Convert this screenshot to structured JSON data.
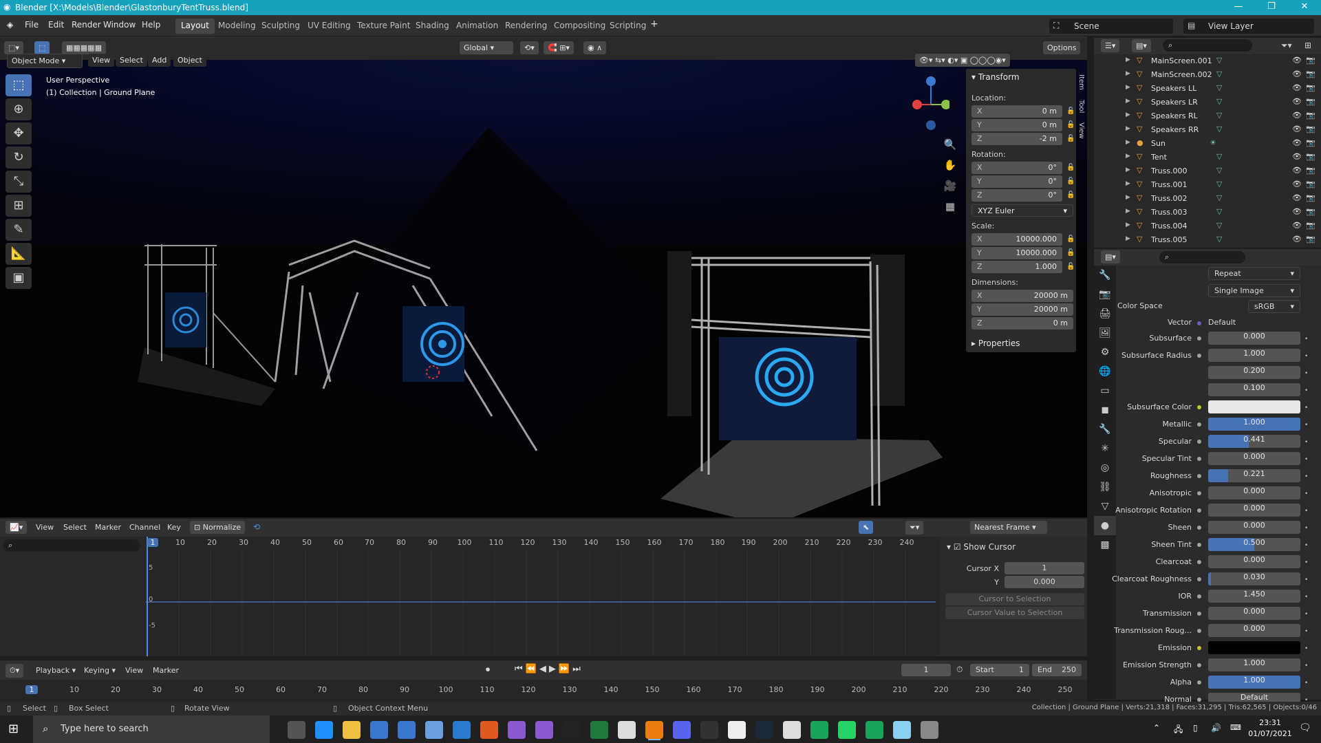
{
  "titlebar": {
    "title": "Blender [X:\\Models\\Blender\\GlastonburyTentTruss.blend]",
    "min": "—",
    "max": "❐",
    "close": "✕"
  },
  "menus": [
    "File",
    "Edit",
    "Render",
    "Window",
    "Help"
  ],
  "workspaces": [
    "Layout",
    "Modeling",
    "Sculpting",
    "UV Editing",
    "Texture Paint",
    "Shading",
    "Animation",
    "Rendering",
    "Compositing",
    "Scripting"
  ],
  "scene": "Scene",
  "view_layer": "View Layer",
  "toolbar": {
    "transform": "Global",
    "options": "Options"
  },
  "vp_header": {
    "mode": "Object Mode",
    "menus": [
      "View",
      "Select",
      "Add",
      "Object"
    ]
  },
  "viewport": {
    "title": "User Perspective",
    "subtitle": "(1) Collection | Ground Plane"
  },
  "npanel": {
    "transform": "Transform",
    "location": "Location:",
    "rotation": "Rotation:",
    "scale": "Scale:",
    "dimensions": "Dimensions:",
    "properties": "Properties",
    "rot_mode": "XYZ Euler",
    "loc": [
      [
        "X",
        "0 m"
      ],
      [
        "Y",
        "0 m"
      ],
      [
        "Z",
        "-2 m"
      ]
    ],
    "rot": [
      [
        "X",
        "0°"
      ],
      [
        "Y",
        "0°"
      ],
      [
        "Z",
        "0°"
      ]
    ],
    "scl": [
      [
        "X",
        "10000.000"
      ],
      [
        "Y",
        "10000.000"
      ],
      [
        "Z",
        "1.000"
      ]
    ],
    "dim": [
      [
        "X",
        "20000 m"
      ],
      [
        "Y",
        "20000 m"
      ],
      [
        "Z",
        "0 m"
      ]
    ],
    "tabs": [
      "Item",
      "Tool",
      "View"
    ]
  },
  "outliner": [
    {
      "name": "MainScreen.001"
    },
    {
      "name": "MainScreen.002"
    },
    {
      "name": "Speakers LL"
    },
    {
      "name": "Speakers LR"
    },
    {
      "name": "Speakers RL"
    },
    {
      "name": "Speakers RR"
    },
    {
      "name": "Sun"
    },
    {
      "name": "Tent"
    },
    {
      "name": "Truss.000"
    },
    {
      "name": "Truss.001"
    },
    {
      "name": "Truss.002"
    },
    {
      "name": "Truss.003"
    },
    {
      "name": "Truss.004"
    },
    {
      "name": "Truss.005"
    }
  ],
  "props": {
    "top": [
      {
        "label": "",
        "value": "Repeat"
      },
      {
        "label": "",
        "value": "Single Image"
      },
      {
        "label": "Color Space",
        "value": "sRGB"
      },
      {
        "label": "Vector",
        "value": "Default"
      }
    ],
    "rows": [
      {
        "label": "Subsurface",
        "value": "0.000",
        "fill": 0
      },
      {
        "label": "Subsurface Radius",
        "value": "1.000",
        "fill": 0
      },
      {
        "label": "",
        "value": "0.200",
        "fill": 0
      },
      {
        "label": "",
        "value": "0.100",
        "fill": 0
      },
      {
        "label": "Subsurface Color",
        "value": "",
        "fill": 0,
        "swatch": "#e8e8e8"
      },
      {
        "label": "Metallic",
        "value": "1.000",
        "fill": 1
      },
      {
        "label": "Specular",
        "value": "0.441",
        "fill": 0.441
      },
      {
        "label": "Specular Tint",
        "value": "0.000",
        "fill": 0
      },
      {
        "label": "Roughness",
        "value": "0.221",
        "fill": 0.221
      },
      {
        "label": "Anisotropic",
        "value": "0.000",
        "fill": 0
      },
      {
        "label": "Anisotropic Rotation",
        "value": "0.000",
        "fill": 0
      },
      {
        "label": "Sheen",
        "value": "0.000",
        "fill": 0
      },
      {
        "label": "Sheen Tint",
        "value": "0.500",
        "fill": 0.5
      },
      {
        "label": "Clearcoat",
        "value": "0.000",
        "fill": 0
      },
      {
        "label": "Clearcoat Roughness",
        "value": "0.030",
        "fill": 0.03
      },
      {
        "label": "IOR",
        "value": "1.450",
        "fill": 0
      },
      {
        "label": "Transmission",
        "value": "0.000",
        "fill": 0
      },
      {
        "label": "Transmission Roug...",
        "value": "0.000",
        "fill": 0
      },
      {
        "label": "Emission",
        "value": "",
        "fill": 0,
        "swatch": "#000000"
      },
      {
        "label": "Emission Strength",
        "value": "1.000",
        "fill": 0
      },
      {
        "label": "Alpha",
        "value": "1.000",
        "fill": 1
      },
      {
        "label": "Normal",
        "value": "Default",
        "fill": 0
      }
    ]
  },
  "graph": {
    "menus": [
      "View",
      "Select",
      "Marker",
      "Channel",
      "Key"
    ],
    "normalize": "Normalize",
    "snap": "Nearest Frame",
    "ticks": [
      "1",
      "10",
      "20",
      "30",
      "40",
      "50",
      "60",
      "70",
      "80",
      "90",
      "100",
      "110",
      "120",
      "130",
      "140",
      "150",
      "160",
      "170",
      "180",
      "190",
      "200",
      "210",
      "220",
      "230",
      "240"
    ],
    "ylabels": [
      "5",
      "0",
      "-5"
    ],
    "cursor": {
      "show": "Show Cursor",
      "xlabel": "Cursor X",
      "x": "1",
      "ylabel": "Y",
      "y": "0.000",
      "to_sel": "Cursor to Selection",
      "val_sel": "Cursor Value to Selection"
    }
  },
  "timeline": {
    "menus": [
      "Playback",
      "Keying",
      "View",
      "Marker"
    ],
    "frame": "1",
    "start_label": "Start",
    "start": "1",
    "end_label": "End",
    "end": "250",
    "ticks": [
      "1",
      "10",
      "20",
      "30",
      "40",
      "50",
      "60",
      "70",
      "80",
      "90",
      "100",
      "110",
      "120",
      "130",
      "140",
      "150",
      "160",
      "170",
      "180",
      "190",
      "200",
      "210",
      "220",
      "230",
      "240",
      "250"
    ]
  },
  "status": {
    "select": "Select",
    "box": "Box Select",
    "rotate": "Rotate View",
    "context": "Object Context Menu",
    "stats": "Collection | Ground Plane | Verts:21,318 | Faces:31,295 | Tris:62,565 | Objects:0/46"
  },
  "taskbar": {
    "search": "Type here to search",
    "time": "23:31",
    "date": "01/07/2021"
  }
}
